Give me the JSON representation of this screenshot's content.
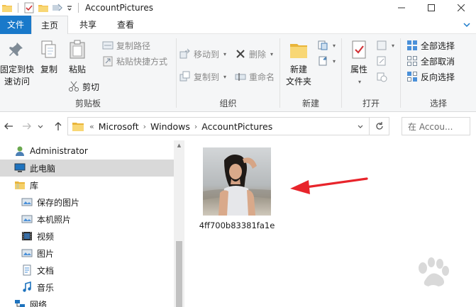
{
  "window": {
    "title": "AccountPictures"
  },
  "tabs": [
    "文件",
    "主页",
    "共享",
    "查看"
  ],
  "ribbon": {
    "clipboard": {
      "label": "剪贴板",
      "pin_label_1": "固定到快",
      "pin_label_2": "速访问",
      "copy": "复制",
      "paste": "粘贴",
      "copy_path": "复制路径",
      "paste_shortcut": "粘贴快捷方式",
      "cut": "剪切"
    },
    "organize": {
      "label": "组织",
      "move_to": "移动到",
      "copy_to": "复制到",
      "delete": "删除",
      "rename": "重命名"
    },
    "new": {
      "label": "新建",
      "new_folder_1": "新建",
      "new_folder_2": "文件夹"
    },
    "open": {
      "label": "打开",
      "properties": "属性"
    },
    "select": {
      "label": "选择",
      "select_all": "全部选择",
      "select_none": "全部取消",
      "invert": "反向选择"
    }
  },
  "address": {
    "prefix": "«",
    "crumbs": [
      "Microsoft",
      "Windows",
      "AccountPictures"
    ]
  },
  "search": {
    "placeholder": "在 Accou..."
  },
  "nav": {
    "items": [
      {
        "label": "Administrator"
      },
      {
        "label": "此电脑"
      },
      {
        "label": "库"
      },
      {
        "label": "保存的图片"
      },
      {
        "label": "本机照片"
      },
      {
        "label": "视频"
      },
      {
        "label": "图片"
      },
      {
        "label": "文档"
      },
      {
        "label": "音乐"
      },
      {
        "label": "网络"
      }
    ]
  },
  "files": [
    {
      "name": "4ff700b83381fa1e"
    }
  ],
  "colors": {
    "accent": "#1979ca",
    "arrow": "#e8242b",
    "selection": "#d9d9d9"
  }
}
